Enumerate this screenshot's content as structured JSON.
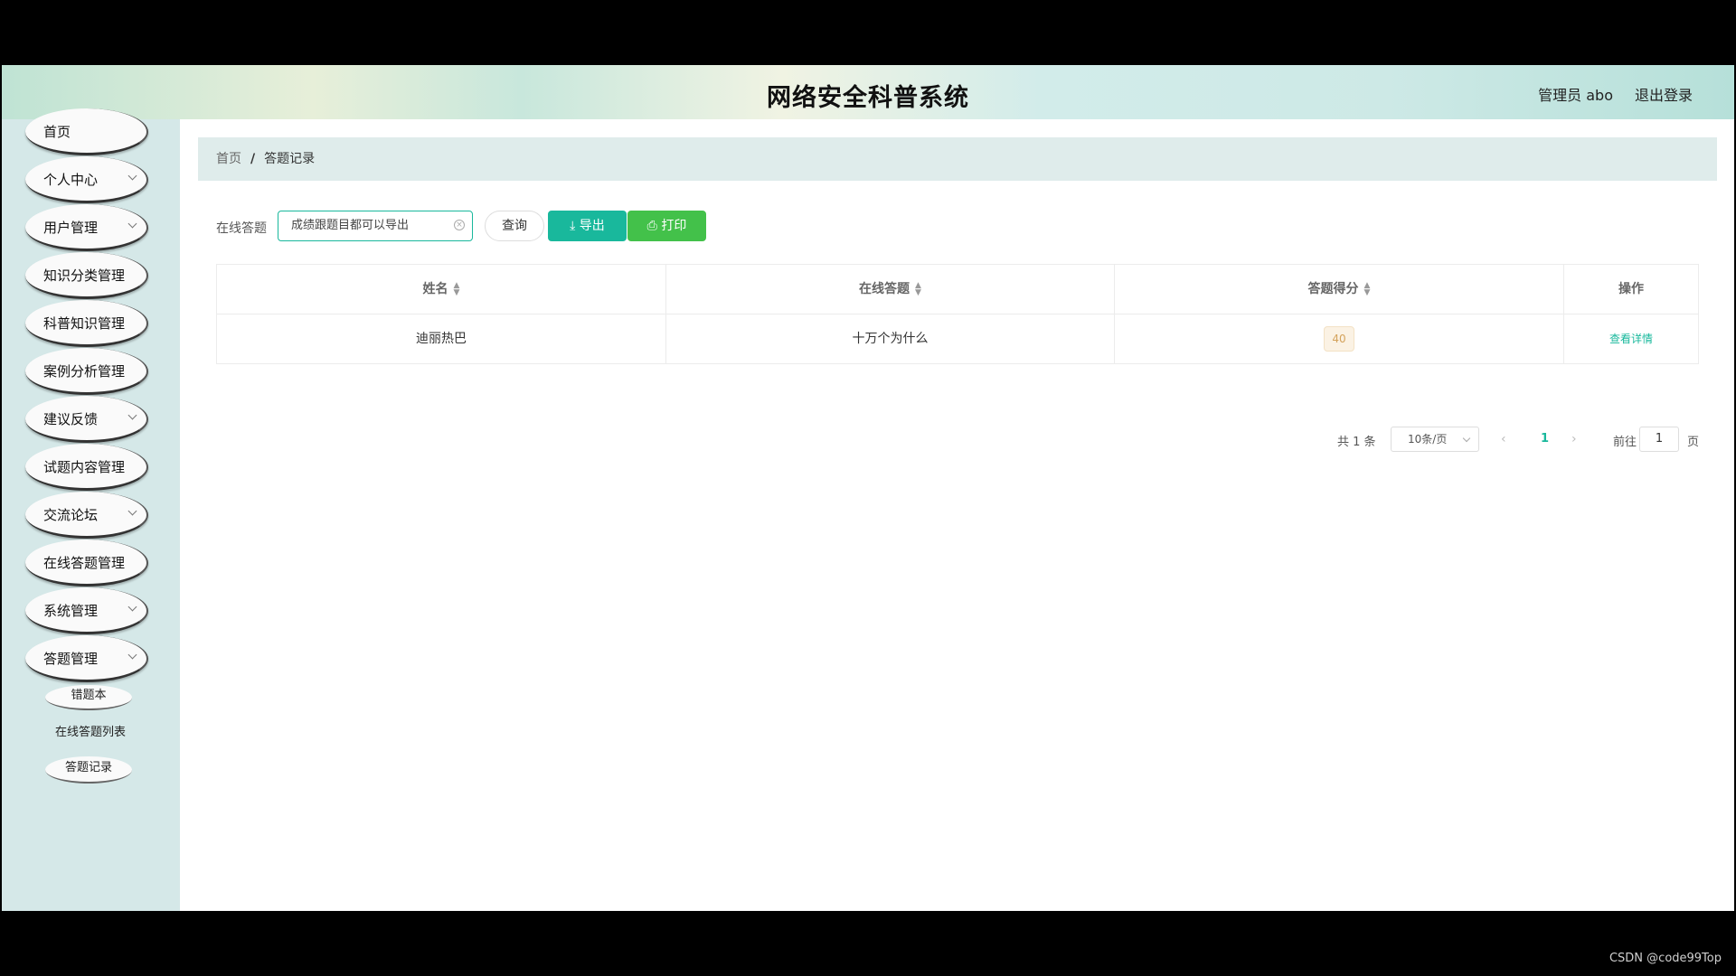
{
  "header": {
    "title": "网络安全科普系统",
    "user": "管理员 abo",
    "logout": "退出登录"
  },
  "sidebar": {
    "items": [
      {
        "label": "首页",
        "expandable": false
      },
      {
        "label": "个人中心",
        "expandable": true
      },
      {
        "label": "用户管理",
        "expandable": true
      },
      {
        "label": "知识分类管理",
        "expandable": false
      },
      {
        "label": "科普知识管理",
        "expandable": false
      },
      {
        "label": "案例分析管理",
        "expandable": false
      },
      {
        "label": "建议反馈",
        "expandable": true
      },
      {
        "label": "试题内容管理",
        "expandable": false
      },
      {
        "label": "交流论坛",
        "expandable": true
      },
      {
        "label": "在线答题管理",
        "expandable": false
      },
      {
        "label": "系统管理",
        "expandable": true
      },
      {
        "label": "答题管理",
        "expandable": true
      }
    ],
    "subitems": [
      "错题本",
      "在线答题列表",
      "答题记录"
    ]
  },
  "breadcrumb": {
    "home": "首页",
    "current": "答题记录"
  },
  "search": {
    "label": "在线答题",
    "value": "成绩跟题目都可以导出",
    "query_label": "查询",
    "export_label": "⤓ 导出",
    "print_label": "⎙ 打印"
  },
  "table": {
    "columns": [
      "姓名",
      "在线答题",
      "答题得分",
      "操作"
    ],
    "rows": [
      {
        "name": "迪丽热巴",
        "exam": "十万个为什么",
        "score": "40",
        "action": "查看详情"
      }
    ]
  },
  "pagination": {
    "total": "共 1 条",
    "page_size": "10条/页",
    "prev": "‹",
    "current": "1",
    "next": "›",
    "goto_label": "前往",
    "goto_value": "1",
    "page_suffix": "页"
  },
  "watermark": "CSDN @code99Top",
  "colors": {
    "accent": "#19b89c",
    "print": "#43c14a",
    "sidebar_bg": "#d5e8e8"
  }
}
